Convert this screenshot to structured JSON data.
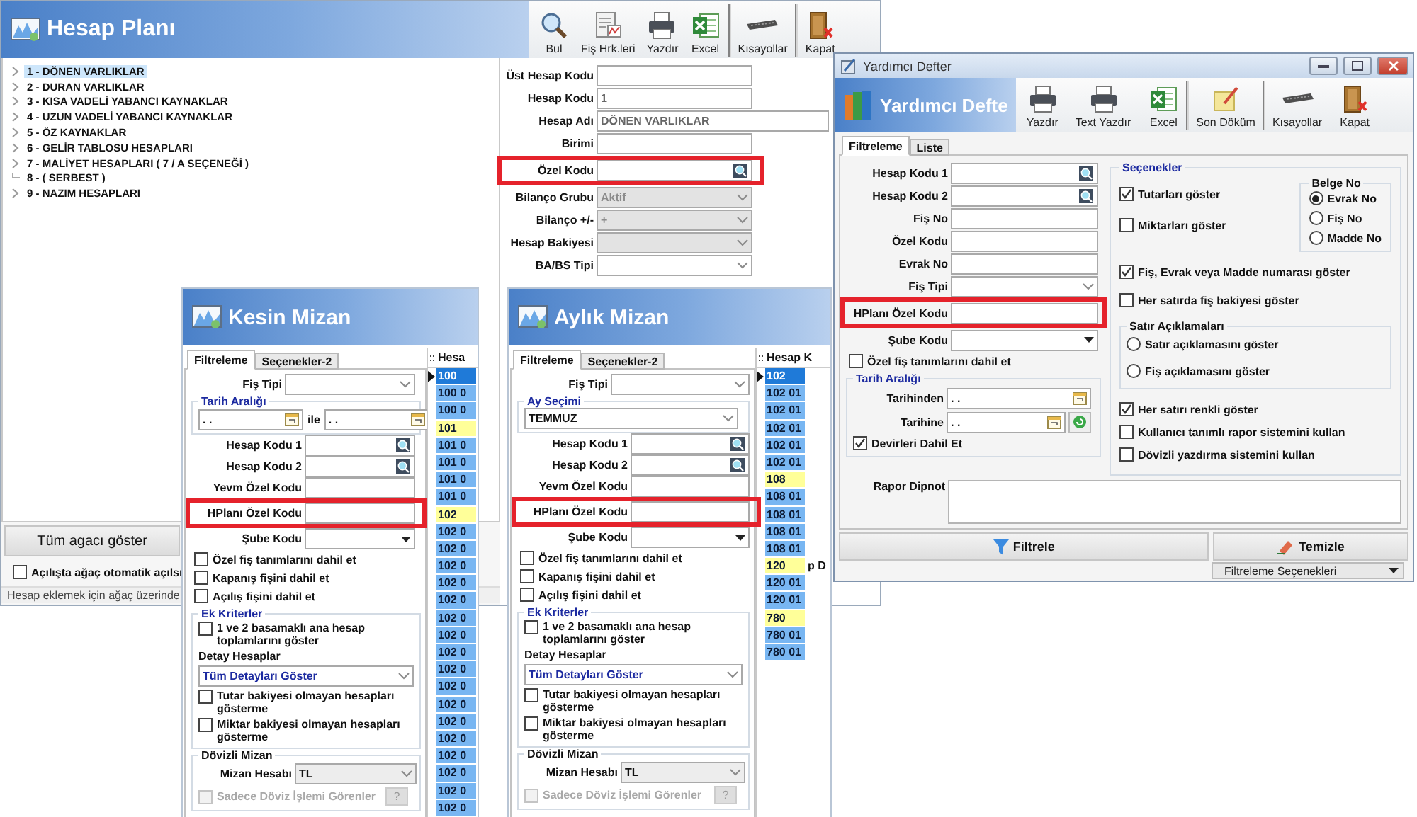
{
  "hesap_plani": {
    "title": "Hesap Planı",
    "toolbar": [
      [
        {
          "label": "Bul",
          "kind": "search"
        },
        {
          "label": "Fiş Hrk.leri",
          "kind": "report"
        },
        {
          "label": "Yazdır",
          "kind": "print"
        },
        {
          "label": "Excel",
          "kind": "excel"
        }
      ],
      [
        {
          "label": "Kısayollar",
          "kind": "shortcuts"
        }
      ],
      [
        {
          "label": "Kapat",
          "kind": "close"
        }
      ]
    ],
    "tree": [
      {
        "label": "1 - DÖNEN VARLIKLAR",
        "selected": true,
        "expandable": true
      },
      {
        "label": "2 - DURAN VARLIKLAR",
        "selected": false,
        "expandable": true
      },
      {
        "label": "3 - KISA VADELİ YABANCI KAYNAKLAR",
        "selected": false,
        "expandable": true
      },
      {
        "label": "4 - UZUN VADELİ YABANCI KAYNAKLAR",
        "selected": false,
        "expandable": true
      },
      {
        "label": "5 - ÖZ KAYNAKLAR",
        "selected": false,
        "expandable": true
      },
      {
        "label": "6 - GELİR TABLOSU HESAPLARI",
        "selected": false,
        "expandable": true
      },
      {
        "label": "7 - MALİYET HESAPLARI ( 7 / A SEÇENEĞİ )",
        "selected": false,
        "expandable": true
      },
      {
        "label": "8 - ( SERBEST )",
        "selected": false,
        "expandable": false
      },
      {
        "label": "9 - NAZIM HESAPLARI",
        "selected": false,
        "expandable": true
      }
    ],
    "form": [
      {
        "label": "Üst Hesap Kodu",
        "kind": "text",
        "disabled": false,
        "highlighted": false
      },
      {
        "label": "Hesap Kodu",
        "kind": "text",
        "value": "1",
        "disabled": false,
        "highlighted": false
      },
      {
        "label": "Hesap Adı",
        "kind": "wide_text",
        "value": "DÖNEN VARLIKLAR",
        "disabled": false,
        "highlighted": false
      },
      {
        "label": "Birimi",
        "kind": "text",
        "disabled": false,
        "highlighted": false
      },
      {
        "label": "Özel Kodu",
        "kind": "lookup",
        "disabled": false,
        "highlighted": true
      },
      {
        "label": "Bilanço Grubu",
        "kind": "select",
        "value": "Aktif",
        "disabled": true,
        "highlighted": false
      },
      {
        "label": "Bilanço +/-",
        "kind": "select",
        "value": "+",
        "disabled": true,
        "highlighted": false
      },
      {
        "label": "Hesap Bakiyesi",
        "kind": "select",
        "disabled": true,
        "highlighted": false
      },
      {
        "label": "BA/BS Tipi",
        "kind": "select",
        "disabled": false,
        "highlighted": false
      }
    ],
    "show_all": "Tüm agacı göster",
    "auto_expand": {
      "label": "Açılışta ağaç otomatik açılsı",
      "checked": false
    },
    "status": "Hesap eklemek için ağaç üzerinde"
  },
  "kesin_mizan": {
    "title": "Kesin Mizan",
    "tabs": [
      {
        "label": "Filtreleme",
        "selected": true
      },
      {
        "label": "Seçenekler-2",
        "selected": false
      }
    ],
    "fields_top": [
      {
        "label": "Fiş Tipi",
        "kind": "select"
      }
    ],
    "period": {
      "kind": "date_range",
      "title": "Tarih Aralığı",
      "from": ". .",
      "joiner": "ile",
      "to": ". ."
    },
    "fields": [
      {
        "label": "Hesap Kodu 1",
        "kind": "lookup",
        "highlighted": false
      },
      {
        "label": "Hesap Kodu 2",
        "kind": "lookup",
        "highlighted": false
      },
      {
        "label": "Yevm Özel Kodu",
        "kind": "text",
        "highlighted": false
      },
      {
        "label": "HPlanı Özel Kodu",
        "kind": "text",
        "highlighted": true
      },
      {
        "label": "Şube Kodu",
        "kind": "combo",
        "highlighted": false
      }
    ],
    "checks": [
      {
        "label": "Özel fiş tanımlarını dahil et",
        "checked": false
      },
      {
        "label": "Kapanış fişini dahil et",
        "checked": false
      },
      {
        "label": "Açılış fişini dahil et",
        "checked": false
      }
    ],
    "ek_kriterler": {
      "title": "Ek Kriterler",
      "top_checks": [
        {
          "label": "1 ve 2 basamaklı ana hesap toplamlarını göster",
          "checked": false
        }
      ],
      "detail": {
        "label": "Detay Hesaplar",
        "value": "Tüm Detayları Göster"
      },
      "checks": [
        {
          "label": "Tutar bakiyesi olmayan hesapları gösterme",
          "checked": false
        },
        {
          "label": "Miktar bakiyesi olmayan hesapları gösterme",
          "checked": false
        }
      ]
    },
    "dovizli": {
      "title": "Dövizli Mizan",
      "field": {
        "label": "Mizan Hesabı",
        "kind": "select",
        "value": "TL"
      },
      "check": {
        "label": "Sadece Döviz İşlemi Görenler",
        "checked": false,
        "disabled": true
      },
      "help": {
        "label": "?",
        "disabled": true
      }
    },
    "grid": {
      "header": "Hesa",
      "rows": [
        {
          "text": "100",
          "kind": "account",
          "selected": true
        },
        {
          "text": "100 0",
          "kind": "account",
          "selected": false
        },
        {
          "text": "100 0",
          "kind": "account",
          "selected": false
        },
        {
          "text": "101",
          "kind": "group",
          "selected": false
        },
        {
          "text": "101 0",
          "kind": "account",
          "selected": false
        },
        {
          "text": "101 0",
          "kind": "account",
          "selected": false
        },
        {
          "text": "101 0",
          "kind": "account",
          "selected": false
        },
        {
          "text": "101 0",
          "kind": "account",
          "selected": false
        },
        {
          "text": "102",
          "kind": "group",
          "selected": false
        },
        {
          "text": "102 0",
          "kind": "account",
          "selected": false
        },
        {
          "text": "102 0",
          "kind": "account",
          "selected": false
        },
        {
          "text": "102 0",
          "kind": "account",
          "selected": false
        },
        {
          "text": "102 0",
          "kind": "account",
          "selected": false
        },
        {
          "text": "102 0",
          "kind": "account",
          "selected": false
        },
        {
          "text": "102 0",
          "kind": "account",
          "selected": false
        },
        {
          "text": "102 0",
          "kind": "account",
          "selected": false
        },
        {
          "text": "102 0",
          "kind": "account",
          "selected": false
        },
        {
          "text": "102 0",
          "kind": "account",
          "selected": false
        },
        {
          "text": "102 0",
          "kind": "account",
          "selected": false
        },
        {
          "text": "102 0",
          "kind": "account",
          "selected": false
        },
        {
          "text": "102 0",
          "kind": "account",
          "selected": false
        },
        {
          "text": "102 0",
          "kind": "account",
          "selected": false
        },
        {
          "text": "102 0",
          "kind": "account",
          "selected": false
        },
        {
          "text": "102 0",
          "kind": "account",
          "selected": false
        },
        {
          "text": "102 0",
          "kind": "account",
          "selected": false
        },
        {
          "text": "102 0",
          "kind": "account",
          "selected": false
        }
      ]
    }
  },
  "aylik_mizan": {
    "title": "Aylık Mizan",
    "tabs": [
      {
        "label": "Filtreleme",
        "selected": true
      },
      {
        "label": "Seçenekler-2",
        "selected": false
      }
    ],
    "fields_top": [
      {
        "label": "Fiş Tipi",
        "kind": "select"
      }
    ],
    "period": {
      "kind": "month",
      "title": "Ay Seçimi",
      "value": "TEMMUZ"
    },
    "fields": [
      {
        "label": "Hesap Kodu 1",
        "kind": "lookup",
        "highlighted": false
      },
      {
        "label": "Hesap Kodu 2",
        "kind": "lookup",
        "highlighted": false
      },
      {
        "label": "Yevm Özel Kodu",
        "kind": "text",
        "highlighted": false
      },
      {
        "label": "HPlanı Özel Kodu",
        "kind": "text",
        "highlighted": true
      },
      {
        "label": "Şube Kodu",
        "kind": "combo",
        "highlighted": false
      }
    ],
    "checks": [
      {
        "label": "Özel fiş tanımlarını dahil et",
        "checked": false
      },
      {
        "label": "Kapanış fişini dahil et",
        "checked": false
      },
      {
        "label": "Açılış fişini dahil et",
        "checked": false
      }
    ],
    "ek_kriterler": {
      "title": "Ek Kriterler",
      "top_checks": [
        {
          "label": "1 ve 2 basamaklı ana hesap toplamlarını göster",
          "checked": false
        }
      ],
      "detail": {
        "label": "Detay Hesaplar",
        "value": "Tüm Detayları Göster"
      },
      "checks": [
        {
          "label": "Tutar bakiyesi olmayan hesapları gösterme",
          "checked": false
        },
        {
          "label": "Miktar bakiyesi olmayan hesapları gösterme",
          "checked": false
        }
      ]
    },
    "dovizli": {
      "title": "Dövizli Mizan",
      "field": {
        "label": "Mizan Hesabı",
        "kind": "select",
        "value": "TL"
      },
      "check": {
        "label": "Sadece Döviz İşlemi Görenler",
        "checked": false,
        "disabled": true
      },
      "help": {
        "label": "?",
        "disabled": true
      }
    },
    "grid": {
      "header": "Hesap K",
      "rows": [
        {
          "text": "102",
          "kind": "account",
          "selected": true
        },
        {
          "text": "102 01",
          "kind": "account",
          "selected": false
        },
        {
          "text": "102 01",
          "kind": "account",
          "selected": false
        },
        {
          "text": "102 01",
          "kind": "account",
          "selected": false
        },
        {
          "text": "102 01",
          "kind": "account",
          "selected": false
        },
        {
          "text": "102 01",
          "kind": "account",
          "selected": false
        },
        {
          "text": "108",
          "kind": "group",
          "selected": false
        },
        {
          "text": "108 01",
          "kind": "account",
          "selected": false
        },
        {
          "text": "108 01",
          "kind": "account",
          "selected": false
        },
        {
          "text": "108 01",
          "kind": "account",
          "selected": false
        },
        {
          "text": "108 01",
          "kind": "account",
          "selected": false
        },
        {
          "text": "120",
          "kind": "group",
          "selected": false,
          "extra": "p D"
        },
        {
          "text": "120 01",
          "kind": "account",
          "selected": false
        },
        {
          "text": "120 01",
          "kind": "account",
          "selected": false
        },
        {
          "text": "780",
          "kind": "group",
          "selected": false
        },
        {
          "text": "780 01",
          "kind": "account",
          "selected": false
        },
        {
          "text": "780 01",
          "kind": "account",
          "selected": false
        }
      ]
    }
  },
  "yardimci_defter": {
    "window_title": "Yardımcı Defter",
    "title": "Yardımcı Defte",
    "toolbar": [
      [
        {
          "label": "Yazdır",
          "kind": "print"
        },
        {
          "label": "Text Yazdır",
          "kind": "print"
        },
        {
          "label": "Excel",
          "kind": "excel"
        }
      ],
      [
        {
          "label": "Son Döküm",
          "kind": "note"
        }
      ],
      [
        {
          "label": "Kısayollar",
          "kind": "shortcuts"
        },
        {
          "label": "Kapat",
          "kind": "close"
        }
      ]
    ],
    "tabs": [
      {
        "label": "Filtreleme",
        "selected": true
      },
      {
        "label": "Liste",
        "selected": false
      }
    ],
    "fields": [
      {
        "label": "Hesap Kodu 1",
        "kind": "lookup",
        "highlighted": false
      },
      {
        "label": "Hesap Kodu 2",
        "kind": "lookup",
        "highlighted": false
      },
      {
        "label": "Fiş No",
        "kind": "text",
        "highlighted": false
      },
      {
        "label": "Özel Kodu",
        "kind": "text",
        "highlighted": false
      },
      {
        "label": "Evrak No",
        "kind": "text",
        "highlighted": false
      },
      {
        "label": "Fiş Tipi",
        "kind": "select",
        "highlighted": false
      },
      {
        "label": "HPlanı Özel Kodu",
        "kind": "text",
        "highlighted": true
      },
      {
        "label": "Şube Kodu",
        "kind": "combo",
        "highlighted": false
      }
    ],
    "check": {
      "label": "Özel fiş tanımlarını dahil et",
      "checked": false
    },
    "date_group": {
      "title": "Tarih Aralığı",
      "fields": [
        {
          "label": "Tarihinden",
          "kind": "date",
          "value": ". ."
        },
        {
          "label": "Tarihine",
          "kind": "date_refresh",
          "value": ". ."
        }
      ],
      "check": {
        "label": "Devirleri Dahil Et",
        "checked": true
      }
    },
    "options": {
      "title": "Seçenekler",
      "checks_a": [
        {
          "label": "Tutarları göster",
          "checked": true
        },
        {
          "label": "Miktarları göster",
          "checked": false
        }
      ],
      "belge_no": {
        "title": "Belge No",
        "options": [
          {
            "label": "Evrak No",
            "selected": true
          },
          {
            "label": "Fiş No",
            "selected": false
          },
          {
            "label": "Madde No",
            "selected": false
          }
        ]
      },
      "checks_b": [
        {
          "label": "Fiş, Evrak veya Madde numarası göster",
          "checked": true
        },
        {
          "label": "Her satırda fiş bakiyesi göster",
          "checked": false
        }
      ],
      "line_notes": {
        "title": "Satır Açıklamaları",
        "options": [
          {
            "label": "Satır açıklamasını göster",
            "selected": false
          },
          {
            "label": "Fiş açıklamasını göster",
            "selected": false
          }
        ]
      },
      "checks_c": [
        {
          "label": "Her satırı renkli göster",
          "checked": true
        },
        {
          "label": "Kullanıcı tanımlı rapor sistemini kullan",
          "checked": false
        },
        {
          "label": "Dövizli yazdırma sistemini kullan",
          "checked": false
        }
      ]
    },
    "note": {
      "label": "Rapor Dipnot"
    },
    "buttons": [
      {
        "label": "Filtrele",
        "kind": "filter"
      },
      {
        "label": "Temizle",
        "kind": "clear"
      }
    ],
    "footer_select": "Filtreleme Seçenekleri"
  }
}
